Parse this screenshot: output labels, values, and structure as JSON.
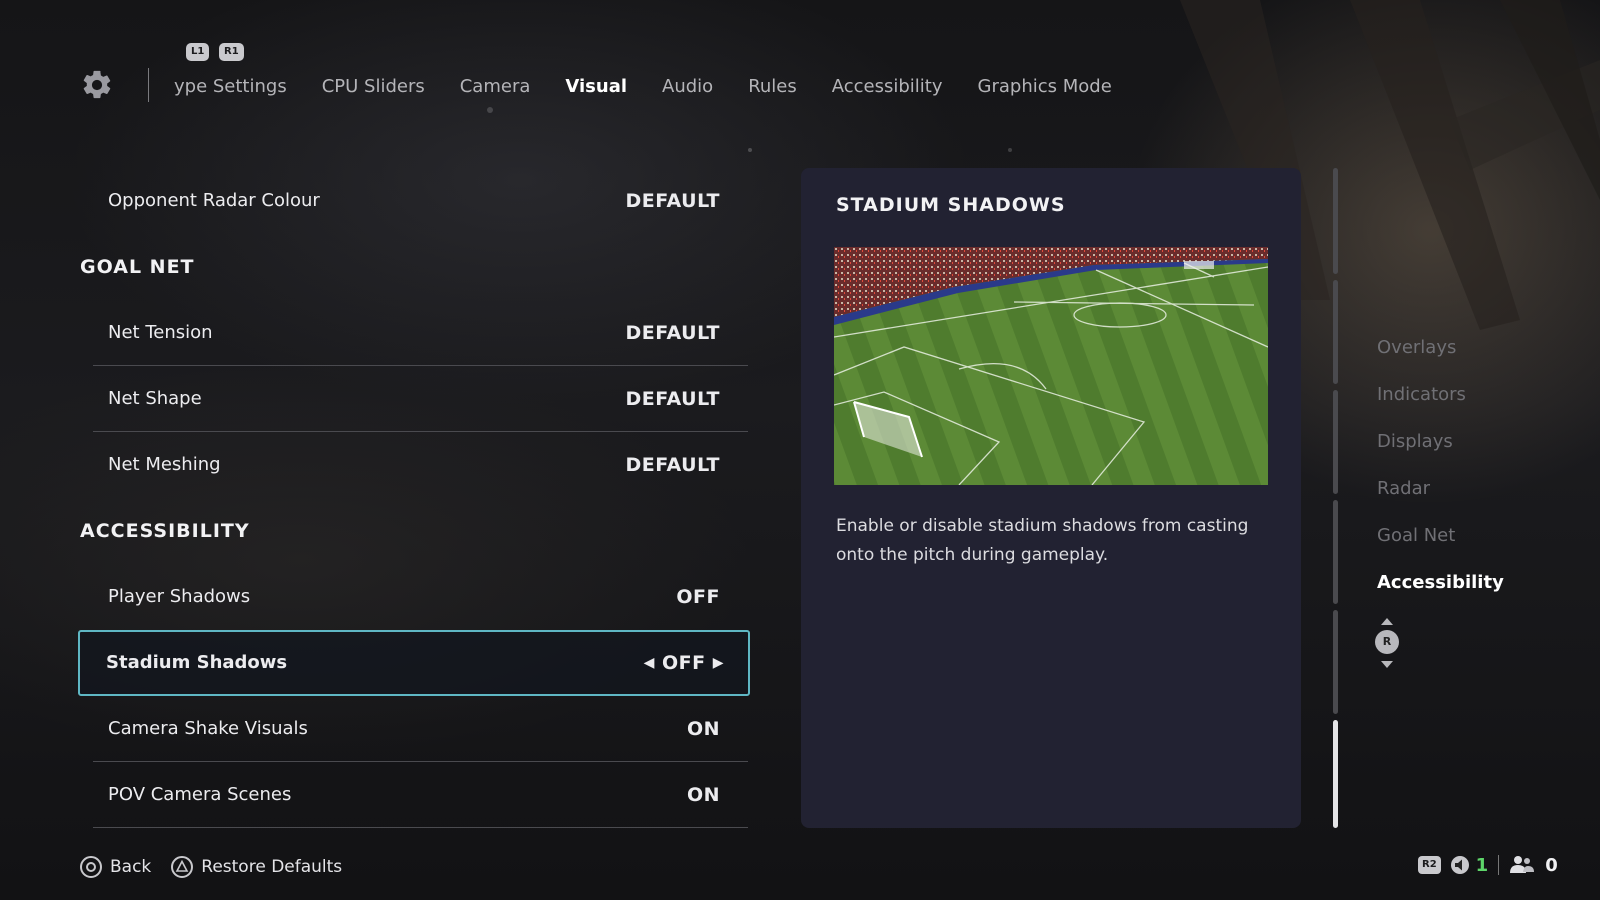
{
  "nav": {
    "shoulder_left": "L1",
    "shoulder_right": "R1",
    "tabs": [
      {
        "label": "ype Settings",
        "active": false
      },
      {
        "label": "CPU Sliders",
        "active": false
      },
      {
        "label": "Camera",
        "active": false
      },
      {
        "label": "Visual",
        "active": true
      },
      {
        "label": "Audio",
        "active": false
      },
      {
        "label": "Rules",
        "active": false
      },
      {
        "label": "Accessibility",
        "active": false
      },
      {
        "label": "Graphics Mode",
        "active": false
      }
    ]
  },
  "settings": {
    "opponent_radar_colour": {
      "label": "Opponent Radar Colour",
      "value": "DEFAULT"
    },
    "goal_net_header": "GOAL NET",
    "net_tension": {
      "label": "Net Tension",
      "value": "DEFAULT"
    },
    "net_shape": {
      "label": "Net Shape",
      "value": "DEFAULT"
    },
    "net_meshing": {
      "label": "Net Meshing",
      "value": "DEFAULT"
    },
    "accessibility_header": "ACCESSIBILITY",
    "player_shadows": {
      "label": "Player Shadows",
      "value": "OFF"
    },
    "stadium_shadows": {
      "label": "Stadium Shadows",
      "value": "OFF",
      "selected": true
    },
    "camera_shake_visuals": {
      "label": "Camera Shake Visuals",
      "value": "ON"
    },
    "pov_camera_scenes": {
      "label": "POV Camera Scenes",
      "value": "ON"
    }
  },
  "panel": {
    "title": "STADIUM SHADOWS",
    "description": "Enable or disable stadium shadows from casting onto the pitch during gameplay."
  },
  "jump_nav": {
    "items": [
      "Overlays",
      "Indicators",
      "Displays",
      "Radar",
      "Goal Net",
      "Accessibility"
    ],
    "active": "Accessibility",
    "stick_label": "R"
  },
  "footer": {
    "back_label": "Back",
    "restore_label": "Restore Defaults"
  },
  "status": {
    "r2_label": "R2",
    "green_count": "1",
    "players_count": "0"
  },
  "colors": {
    "accent_border": "#5fb7c4",
    "panel_bg": "#222232",
    "status_green": "#5ed66a"
  },
  "scroll": {
    "segments": 6,
    "active_segment": 6
  }
}
